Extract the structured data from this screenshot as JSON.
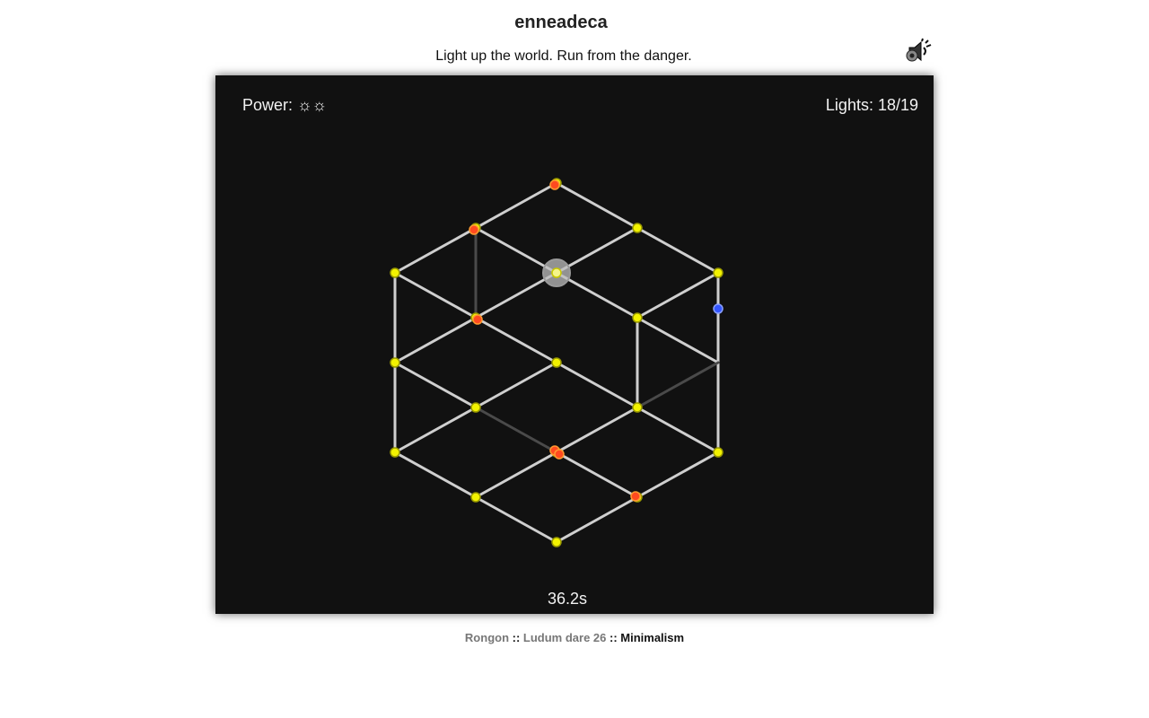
{
  "header": {
    "title": "enneadeca",
    "subtitle": "Light up the world. Run from the danger."
  },
  "sound_toggle": {
    "icon": "speaker-icon"
  },
  "hud": {
    "power_label": "Power:",
    "power_symbols": "☼☼",
    "lights_text": "Lights: 18/19",
    "timer_text": "36.2s"
  },
  "colors": {
    "background": "#111111",
    "edge": "#cfcfcf",
    "edge_dim": "#4a4a4a",
    "node_lit": "#f2f200",
    "enemy": "#ff4a20",
    "player_node": "#3355ff"
  },
  "footer": {
    "author": "Rongon",
    "sep1": " :: ",
    "event": "Ludum dare 26",
    "sep2": " :: ",
    "theme": "Minimalism"
  }
}
